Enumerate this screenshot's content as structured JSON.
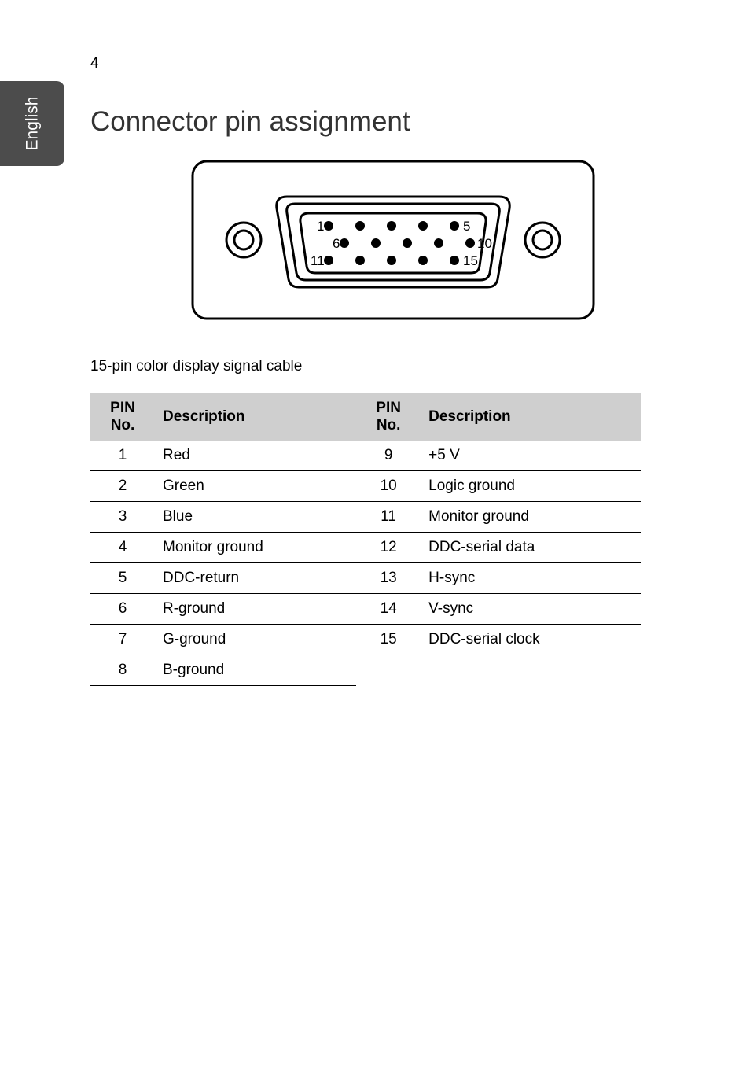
{
  "page_number": "4",
  "side_tab": "English",
  "heading": "Connector pin assignment",
  "caption": "15-pin color display signal cable",
  "diagram": {
    "pin_labels": {
      "r1_start": "1",
      "r1_end": "5",
      "r2_start": "6",
      "r2_end": "10",
      "r3_start": "11",
      "r3_end": "15"
    }
  },
  "table": {
    "headers": {
      "pin_no": "PIN No.",
      "description": "Description"
    },
    "rows": [
      {
        "l_no": "1",
        "l_desc": "Red",
        "r_no": "9",
        "r_desc": "+5 V"
      },
      {
        "l_no": "2",
        "l_desc": "Green",
        "r_no": "10",
        "r_desc": "Logic ground"
      },
      {
        "l_no": "3",
        "l_desc": "Blue",
        "r_no": "11",
        "r_desc": "Monitor ground"
      },
      {
        "l_no": "4",
        "l_desc": "Monitor ground",
        "r_no": "12",
        "r_desc": "DDC-serial data"
      },
      {
        "l_no": "5",
        "l_desc": "DDC-return",
        "r_no": "13",
        "r_desc": "H-sync"
      },
      {
        "l_no": "6",
        "l_desc": "R-ground",
        "r_no": "14",
        "r_desc": "V-sync"
      },
      {
        "l_no": "7",
        "l_desc": "G-ground",
        "r_no": "15",
        "r_desc": "DDC-serial clock"
      },
      {
        "l_no": "8",
        "l_desc": "B-ground",
        "r_no": "",
        "r_desc": ""
      }
    ]
  }
}
